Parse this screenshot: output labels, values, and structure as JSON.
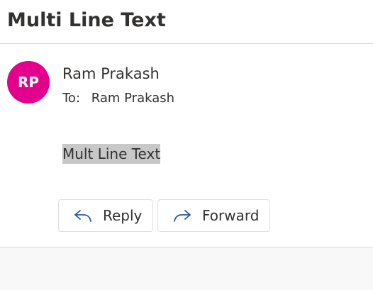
{
  "message": {
    "subject": "Multi Line Text",
    "sender": {
      "initials": "RP",
      "name": "Ram Prakash",
      "avatar_color": "#e3008c"
    },
    "to": {
      "label": "To:",
      "recipient": "Ram Prakash"
    },
    "body": "Mult Line Text"
  },
  "actions": {
    "reply_label": "Reply",
    "reply_icon": "reply-icon",
    "forward_label": "Forward",
    "forward_icon": "forward-icon"
  },
  "colors": {
    "text": "#323130",
    "icon_accent": "#2b579a",
    "highlight": "#c8c8c8"
  }
}
